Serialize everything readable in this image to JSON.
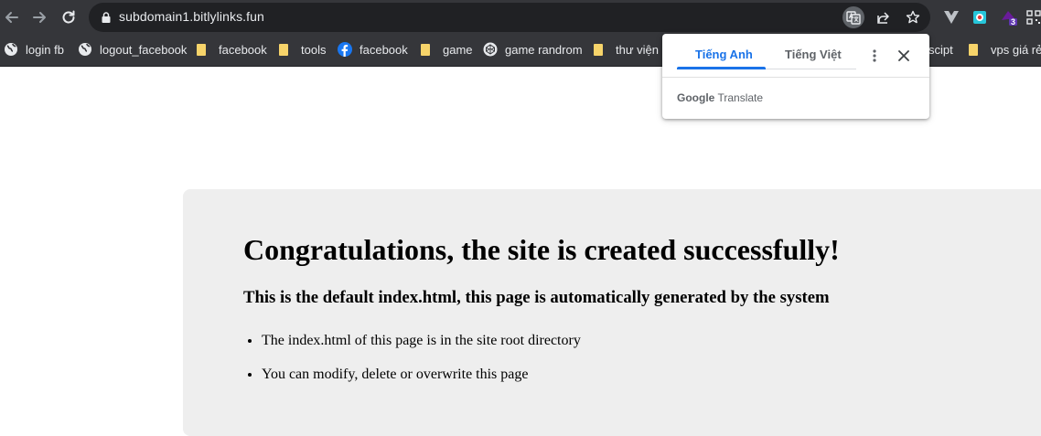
{
  "browser": {
    "url": "subdomain1.bitlylinks.fun",
    "extension_badge": "3",
    "bookmarks": [
      {
        "label": "login fb",
        "icon": "globe-icon"
      },
      {
        "label": "logout_facebook",
        "icon": "globe-icon"
      },
      {
        "label": "facebook",
        "icon": "folder-icon"
      },
      {
        "label": "tools",
        "icon": "folder-icon"
      },
      {
        "label": "facebook",
        "icon": "facebook-icon"
      },
      {
        "label": "game",
        "icon": "folder-icon"
      },
      {
        "label": "game randrom",
        "icon": "codepen-icon"
      },
      {
        "label": "thư viện",
        "icon": "folder-icon"
      },
      {
        "label": "scipt",
        "icon": "folder-icon"
      },
      {
        "label": "vps giá rẻ",
        "icon": "folder-icon"
      }
    ]
  },
  "translate_popup": {
    "tab_source": "Tiếng Anh",
    "tab_target": "Tiếng Việt",
    "brand_google": "Google",
    "brand_translate": "Translate"
  },
  "page": {
    "heading": "Congratulations, the site is created successfully!",
    "subheading": "This is the default index.html, this page is automatically generated by the system",
    "bullets": [
      "The index.html of this page is in the site root directory",
      "You can modify, delete or overwrite this page"
    ]
  },
  "colors": {
    "toolbar_bg": "#35363a",
    "omnibox_bg": "#202124",
    "panel_bg": "#eeeeee",
    "accent": "#1a73e8"
  }
}
